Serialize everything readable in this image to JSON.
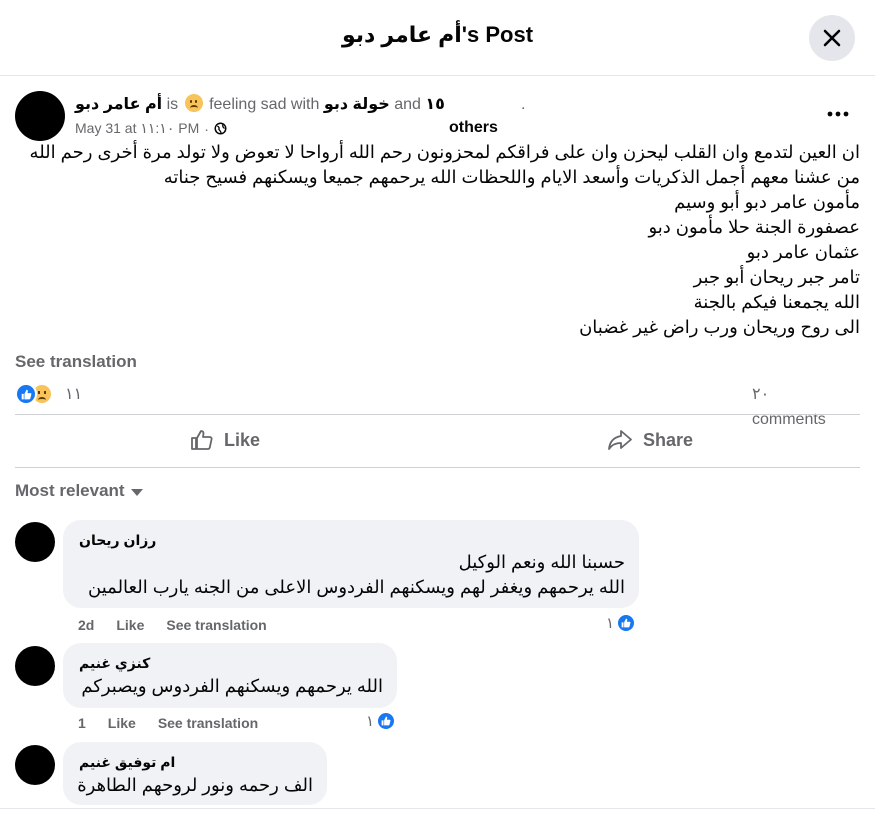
{
  "header": {
    "title": "أم عامر دبو's Post"
  },
  "post": {
    "author": "أم عامر دبو",
    "is_text": "is",
    "feeling": "feeling sad with",
    "tagged": "خولة دبو",
    "and_text": "and",
    "others_count": "١٥",
    "dot": ".",
    "others_label": "others",
    "date": "May 31 at ١١:١٠ PM",
    "meta_sep": "·",
    "lines": [
      "ان العين لتدمع وان القلب ليحزن وان على فراقكم لمحزونون رحم الله أرواحا لا تعوض ولا تولد مرة أخرى رحم الله",
      "من عشنا معهم أجمل الذكريات وأسعد الايام واللحظات الله يرحمهم جميعا ويسكنهم فسيح جناته",
      "مأمون عامر دبو أبو وسيم",
      "عصفورة الجنة حلا مأمون دبو",
      "عثمان عامر دبو",
      "تامر جبر ريحان أبو جبر",
      "الله يجمعنا فيكم بالجنة",
      "الى روح وريحان ورب راض غير غضبان"
    ],
    "see_translation": "See translation",
    "reaction_count": "١١",
    "comments_number": "٢٠",
    "comments_label": "comments"
  },
  "actions": {
    "like": "Like",
    "share": "Share"
  },
  "filter": {
    "label": "Most relevant"
  },
  "comments": [
    {
      "name": "رزان ريحان",
      "lines": [
        "حسبنا الله ونعم الوكيل",
        "الله يرحمهم ويغفر لهم ويسكنهم الفردوس الاعلى من الجنه يارب العالمين"
      ],
      "time": "2d",
      "like": "Like",
      "translate": "See translation",
      "reactions": "١"
    },
    {
      "name": "كنزي غنيم",
      "lines": [
        "الله يرحمهم ويسكنهم الفردوس ويصبركم"
      ],
      "time": "1",
      "like": "Like",
      "translate": "See translation",
      "reactions": "١"
    },
    {
      "name": "ام توفيق غنيم",
      "lines": [
        "الف رحمه ونور لروحهم الطاهرة"
      ]
    }
  ],
  "colors": {
    "accent": "#1877f2",
    "secondary_text": "#65676b",
    "bubble": "#f0f2f5"
  }
}
